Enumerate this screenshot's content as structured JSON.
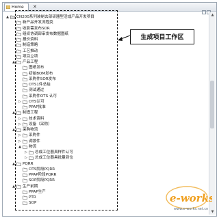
{
  "window": {
    "tab_title": "Home",
    "tab_close": "✕"
  },
  "tree": [
    {
      "label": "CN200系列装制去部研器型活成产品开发项目",
      "level": 0,
      "twisty": "▲",
      "icon": "root-icon"
    },
    {
      "label": "新产品开发流程类",
      "level": 1,
      "twisty": "",
      "icon": "folder-icon"
    },
    {
      "label": "收影需发布SOR",
      "level": 1,
      "twisty": "",
      "icon": "folder-icon"
    },
    {
      "label": "组织协调部审发布数据图纸",
      "level": 1,
      "twisty": "",
      "icon": "folder-icon"
    },
    {
      "label": "报价资料",
      "level": 1,
      "twisty": "",
      "icon": "folder-icon"
    },
    {
      "label": "制造策略",
      "level": 1,
      "twisty": "",
      "icon": "folder-icon"
    },
    {
      "label": "工艺推动",
      "level": 1,
      "twisty": "",
      "icon": "folder-icon"
    },
    {
      "label": "项目立项",
      "level": 1,
      "twisty": "",
      "icon": "folder-icon"
    },
    {
      "label": "产品工程",
      "level": 1,
      "twisty": "▲",
      "icon": "folder-icon"
    },
    {
      "label": "图纸发布",
      "level": 2,
      "twisty": "",
      "icon": "folder-icon"
    },
    {
      "label": "初始BOM发布",
      "level": 2,
      "twisty": "",
      "icon": "folder-icon"
    },
    {
      "label": "采购件SOR发布",
      "level": 2,
      "twisty": "",
      "icon": "folder-icon"
    },
    {
      "label": "OTS1件总结",
      "level": 2,
      "twisty": "",
      "icon": "folder-icon"
    },
    {
      "label": "测试通过",
      "level": 2,
      "twisty": "",
      "icon": "folder-icon"
    },
    {
      "label": "采购件OTS 认可",
      "level": 2,
      "twisty": "",
      "icon": "folder-icon"
    },
    {
      "label": "OTS认可",
      "level": 2,
      "twisty": "▷",
      "icon": "folder-icon"
    },
    {
      "label": "PPAP批准",
      "level": 2,
      "twisty": "",
      "icon": "folder-icon"
    },
    {
      "label": "制造工程",
      "level": 1,
      "twisty": "▲",
      "icon": "folder-icon"
    },
    {
      "label": "技术资料",
      "level": 2,
      "twisty": "▷",
      "icon": "folder-icon"
    },
    {
      "label": "设备（采购）",
      "level": 2,
      "twisty": "▷",
      "icon": "folder-icon"
    },
    {
      "label": "采购物流",
      "level": 1,
      "twisty": "▲",
      "icon": "folder-icon"
    },
    {
      "label": "采购件",
      "level": 2,
      "twisty": "▷",
      "icon": "folder-icon"
    },
    {
      "label": "调拨件",
      "level": 2,
      "twisty": "▷",
      "icon": "folder-icon"
    },
    {
      "label": "物流",
      "level": 2,
      "twisty": "▲",
      "icon": "folder-icon"
    },
    {
      "label": "总成工位器具样件认可",
      "level": 3,
      "twisty": "▷",
      "icon": "folder-icon"
    },
    {
      "label": "总成工位器具批量到位",
      "level": 3,
      "twisty": "▷",
      "icon": "folder-icon"
    },
    {
      "label": "PQRR",
      "level": 1,
      "twisty": "▲",
      "icon": "folder-icon"
    },
    {
      "label": "OTS阶段PQRR",
      "level": 2,
      "twisty": "",
      "icon": "folder-icon"
    },
    {
      "label": "PPAP阶段PQRR",
      "level": 2,
      "twisty": "",
      "icon": "folder-icon"
    },
    {
      "label": "SOP阶段PQRR",
      "level": 2,
      "twisty": "",
      "icon": "folder-icon"
    },
    {
      "label": "生产前期",
      "level": 1,
      "twisty": "▲",
      "icon": "folder-icon"
    },
    {
      "label": "PPAP生产",
      "level": 2,
      "twisty": "",
      "icon": "folder-icon"
    },
    {
      "label": "PTR",
      "level": 2,
      "twisty": "",
      "icon": "folder-icon"
    },
    {
      "label": "SOP",
      "level": 2,
      "twisty": "",
      "icon": "folder-icon"
    }
  ],
  "annotation": {
    "callout_text": "生成项目工作区"
  },
  "watermark": {
    "logo_text": "e-works",
    "url_text": "www.e-works.net.cn",
    "brand_color": "#f0a020"
  }
}
